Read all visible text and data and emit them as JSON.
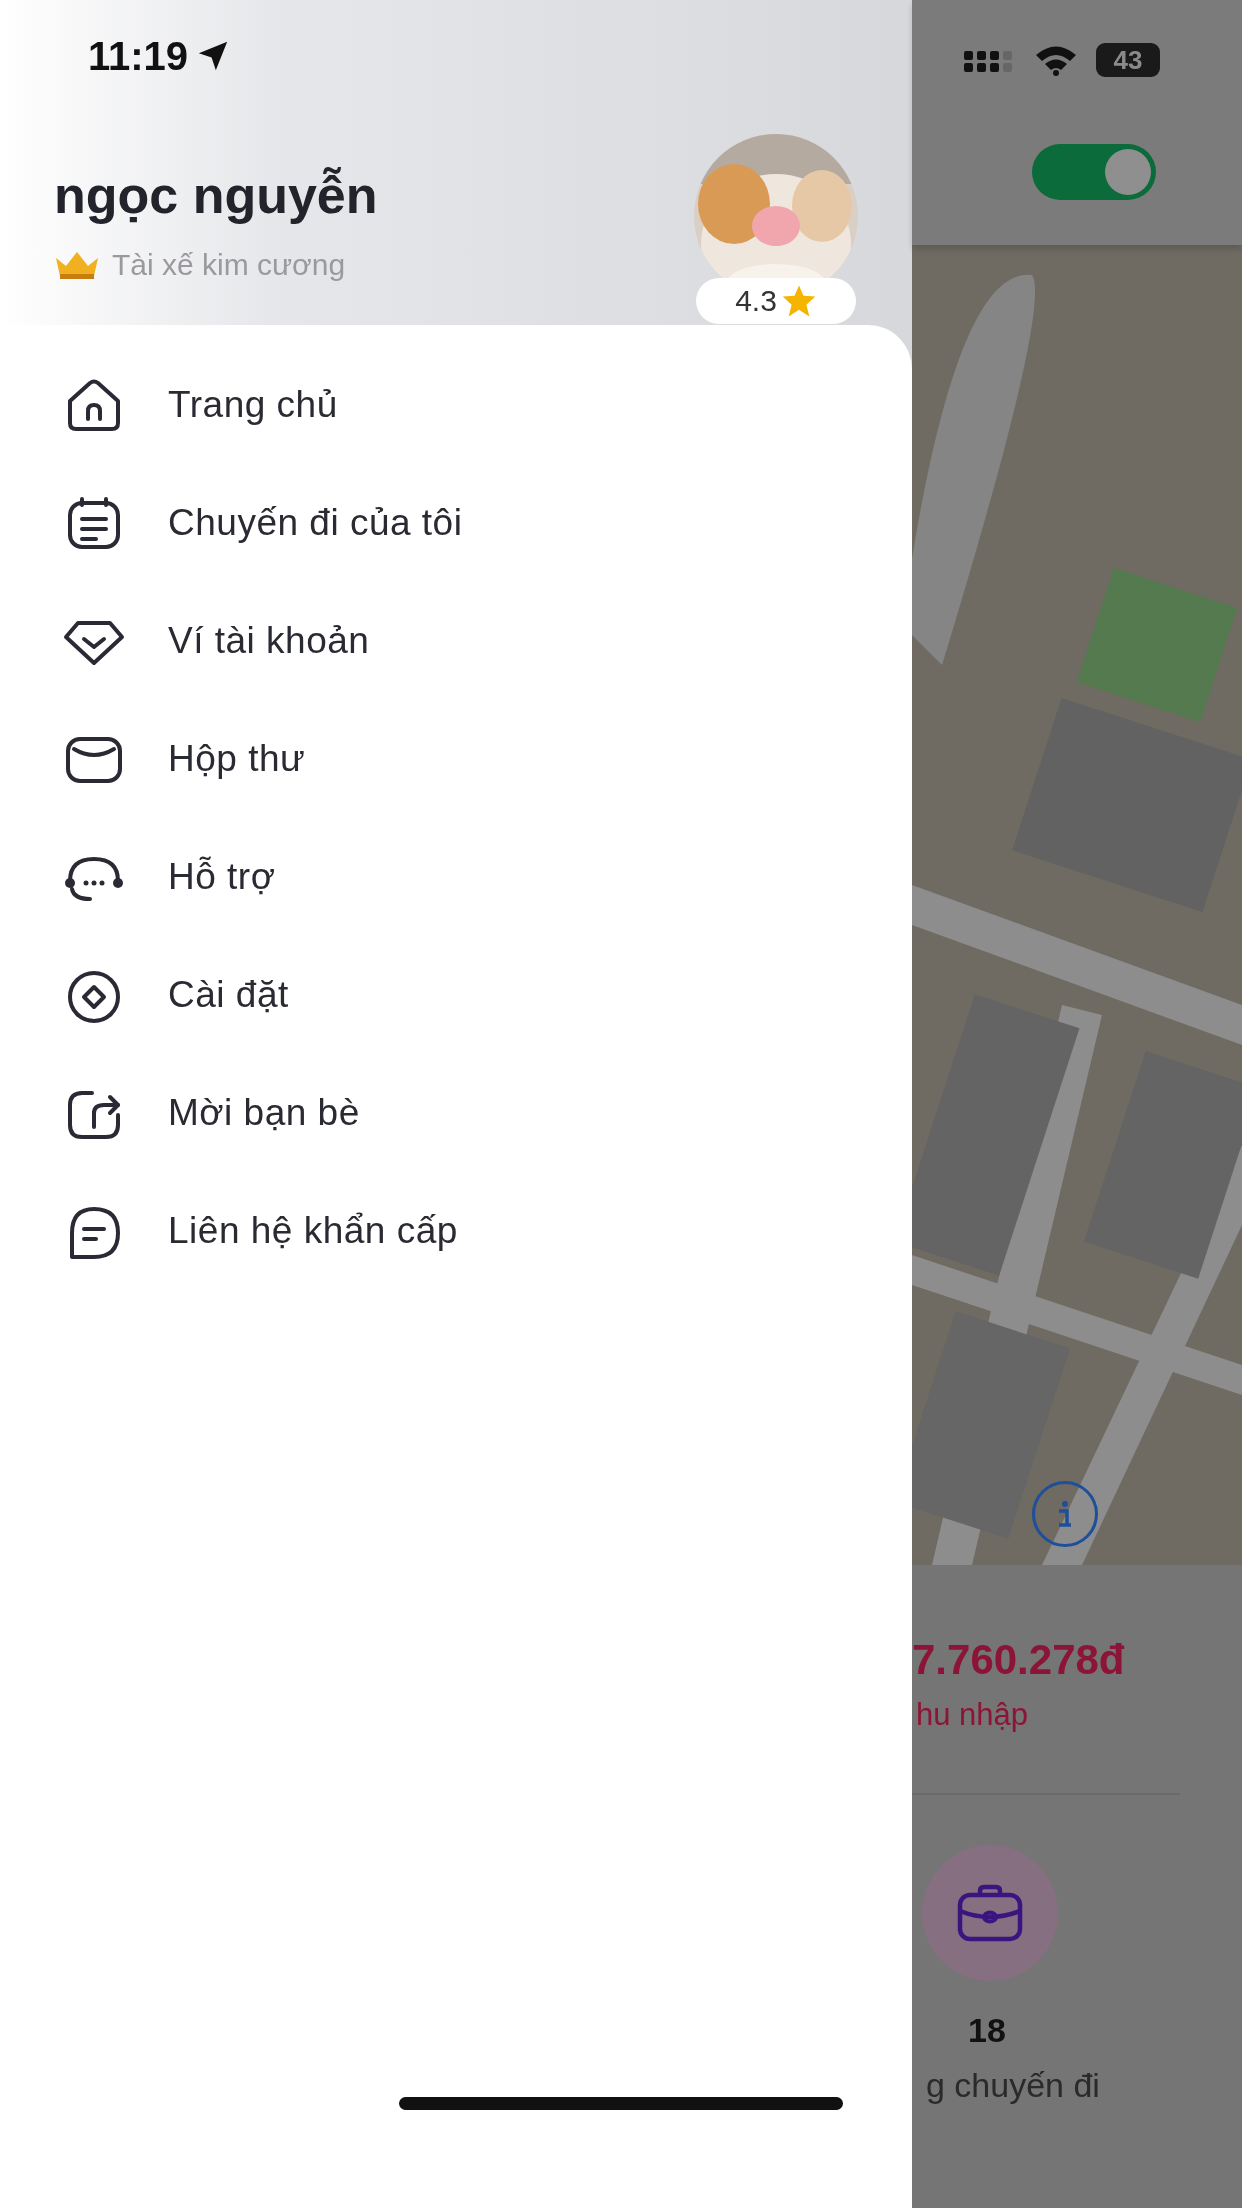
{
  "status_bar": {
    "time": "11:19",
    "battery": "43"
  },
  "profile": {
    "name": "ngọc nguyễn",
    "tier": "Tài xế kim cương",
    "rating": "4.3"
  },
  "menu": {
    "items": [
      {
        "label": "Trang chủ",
        "kind": "home"
      },
      {
        "label": "Chuyến đi của tôi",
        "kind": "trips"
      },
      {
        "label": "Ví tài khoản",
        "kind": "wallet"
      },
      {
        "label": "Hộp thư",
        "kind": "mail"
      },
      {
        "label": "Hỗ trợ",
        "kind": "support"
      },
      {
        "label": "Cài đặt",
        "kind": "settings"
      },
      {
        "label": "Mời bạn bè",
        "kind": "share"
      },
      {
        "label": "Liên hệ khẩn cấp",
        "kind": "message"
      }
    ]
  },
  "background": {
    "online_toggle": {
      "on": true
    },
    "earnings": {
      "amount": "7.760.278đ",
      "label": "hu nhập"
    },
    "trips": {
      "count": "18",
      "label": "g chuyến đi"
    }
  }
}
